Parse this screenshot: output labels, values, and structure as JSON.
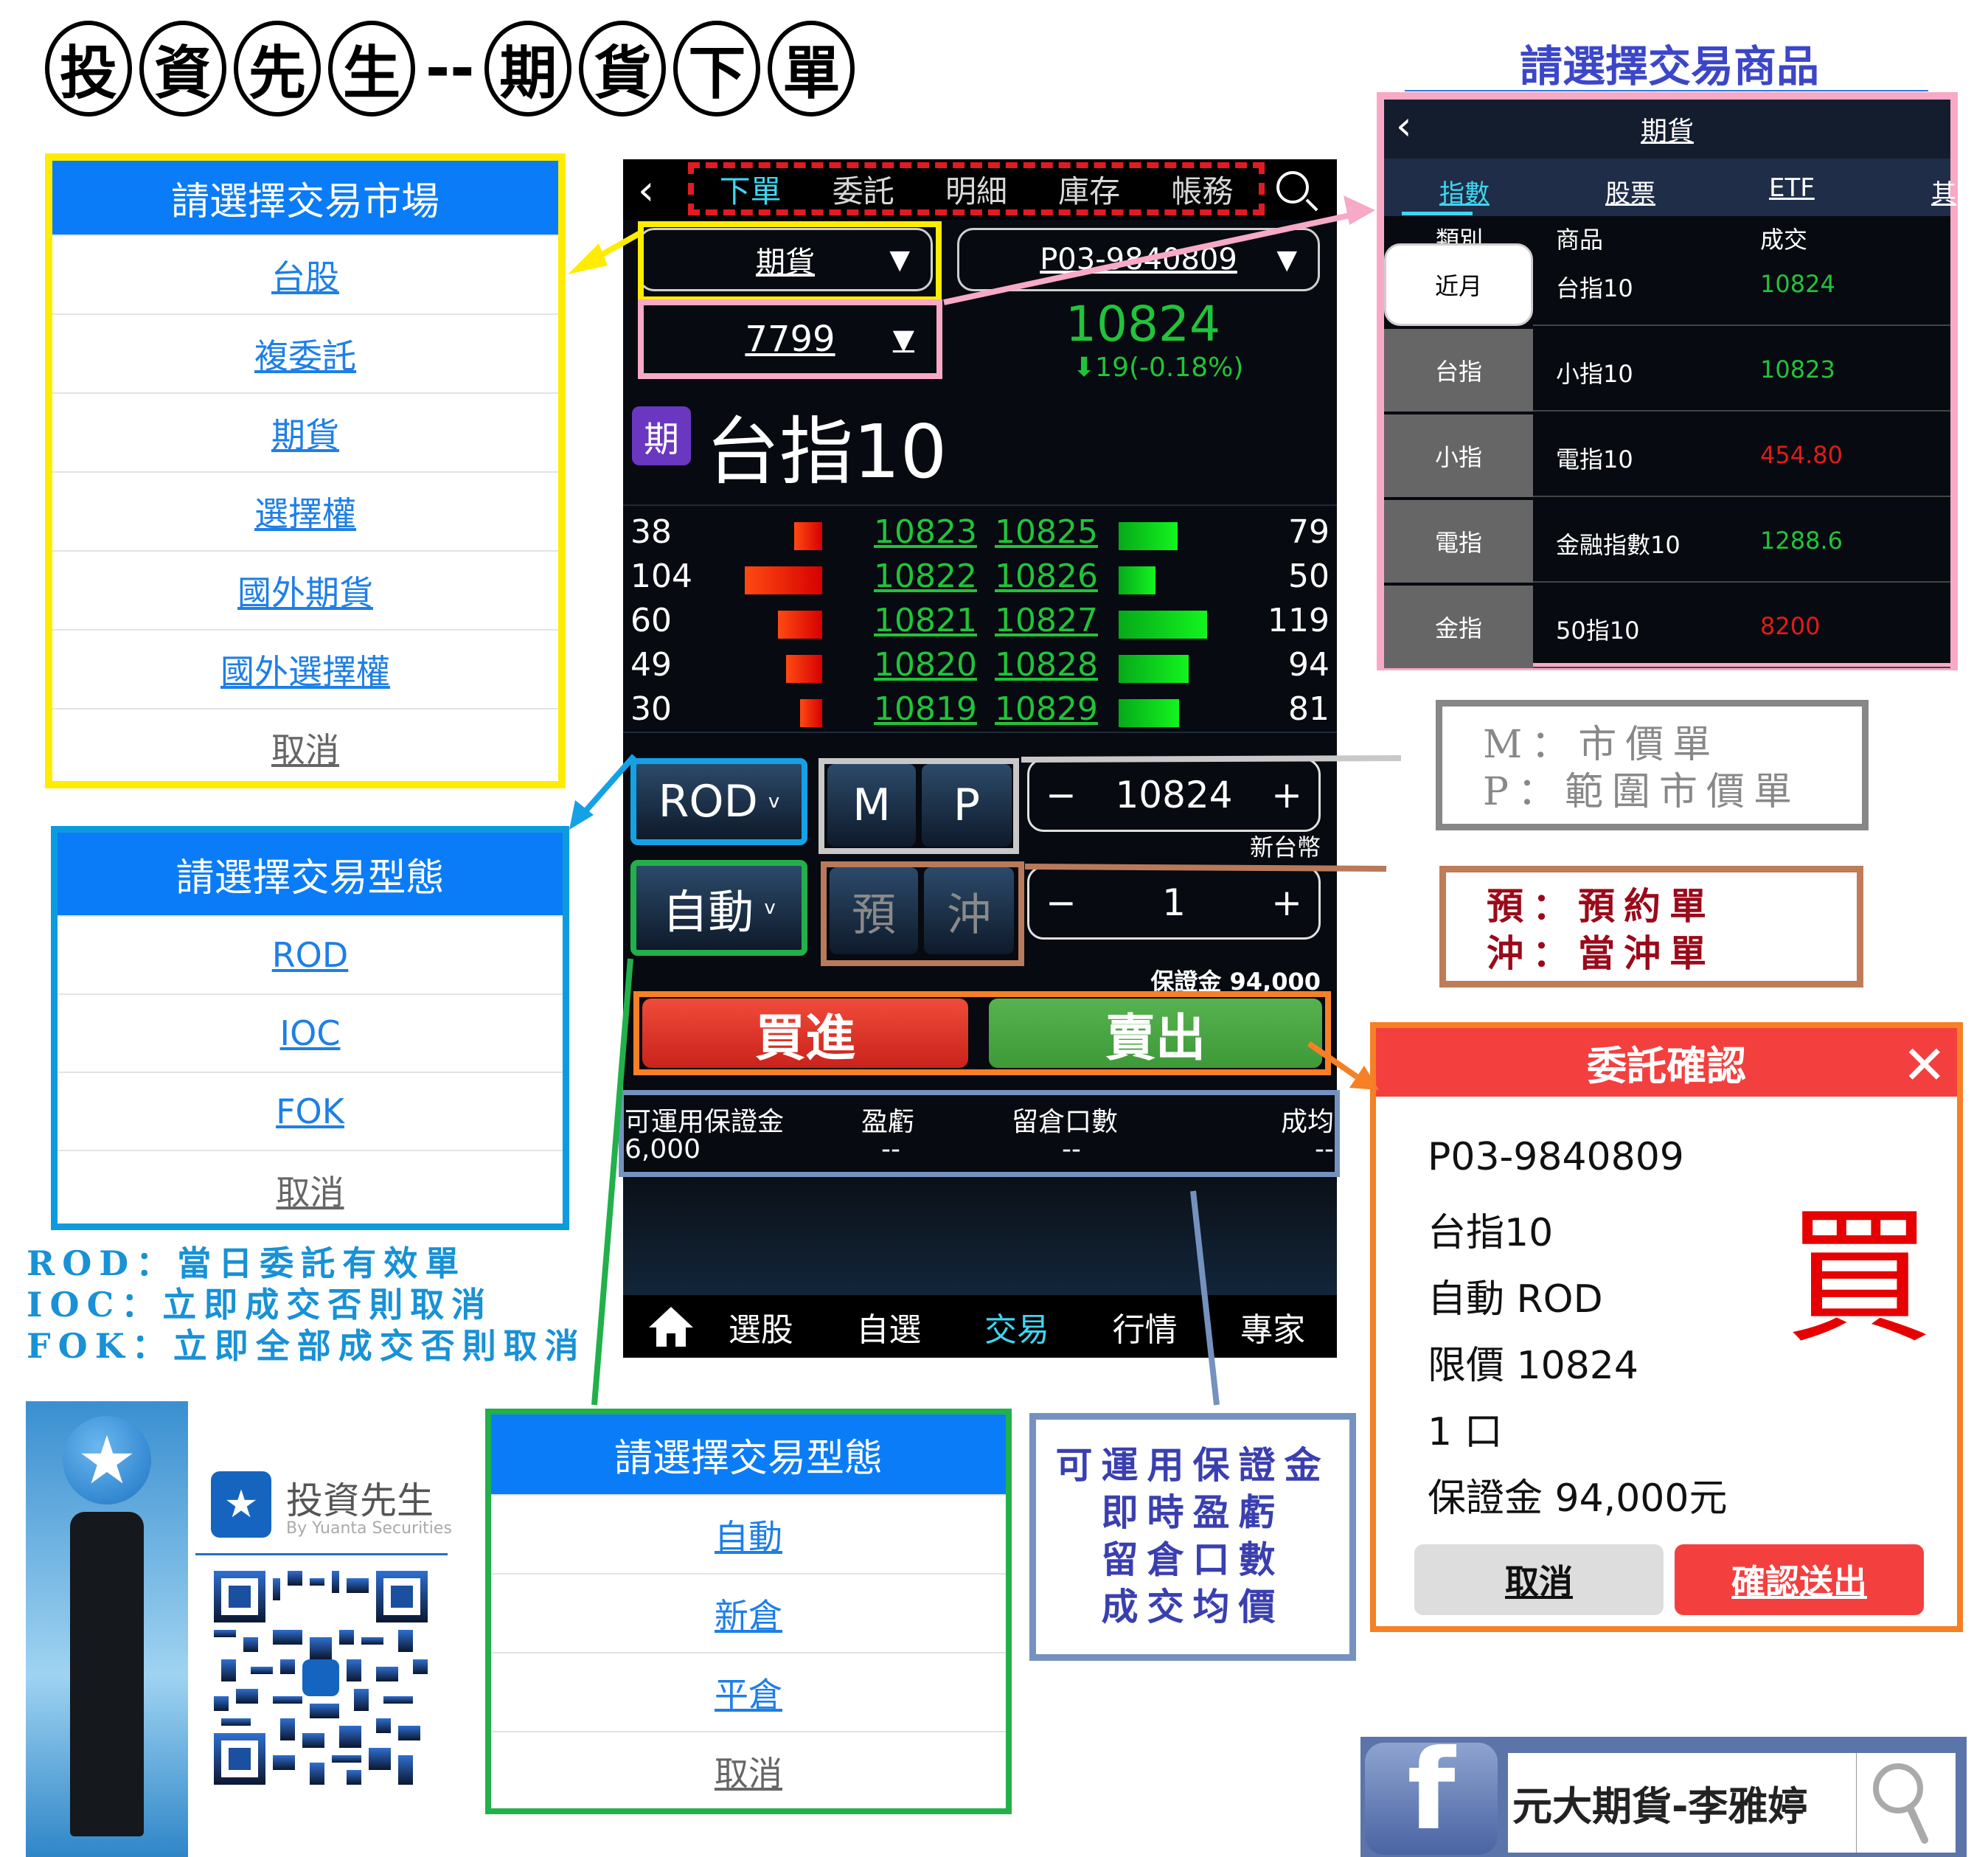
{
  "page_title": {
    "chars_left": [
      "投",
      "資",
      "先",
      "生"
    ],
    "separator": "--",
    "chars_right": [
      "期",
      "貨",
      "下",
      "單"
    ]
  },
  "phone": {
    "tabs": [
      {
        "label": "下單",
        "active": true
      },
      {
        "label": "委託",
        "active": false
      },
      {
        "label": "明細",
        "active": false
      },
      {
        "label": "庫存",
        "active": false
      },
      {
        "label": "帳務",
        "active": false
      }
    ],
    "market_select": "期貨",
    "account_select": "P03-9840809",
    "product_code_select": "7799",
    "last_price": "10824",
    "change": "19(-0.18%)",
    "change_direction": "down",
    "product_badge": "期",
    "product_name": "台指10",
    "order_book": [
      {
        "bid_qty": "38",
        "bid_price": "10823",
        "ask_price": "10825",
        "ask_qty": "79",
        "bid_bar": 38,
        "ask_bar": 79
      },
      {
        "bid_qty": "104",
        "bid_price": "10822",
        "ask_price": "10826",
        "ask_qty": "50",
        "bid_bar": 104,
        "ask_bar": 50
      },
      {
        "bid_qty": "60",
        "bid_price": "10821",
        "ask_price": "10827",
        "ask_qty": "119",
        "bid_bar": 60,
        "ask_bar": 119
      },
      {
        "bid_qty": "49",
        "bid_price": "10820",
        "ask_price": "10828",
        "ask_qty": "94",
        "bid_bar": 49,
        "ask_bar": 94
      },
      {
        "bid_qty": "30",
        "bid_price": "10819",
        "ask_price": "10829",
        "ask_qty": "81",
        "bid_bar": 30,
        "ask_bar": 81
      }
    ],
    "order_type": "ROD",
    "market_btn": "M",
    "range_btn": "P",
    "price_minus": "−",
    "price_value": "10824",
    "price_plus": "+",
    "currency": "新台幣",
    "position_type": "自動",
    "reserve_btn": "預",
    "daytrade_btn": "沖",
    "qty_minus": "−",
    "qty_value": "1",
    "qty_plus": "+",
    "margin_label": "保證金 94,000",
    "buy_label": "買進",
    "sell_label": "賣出",
    "account_info": {
      "headers": [
        "可運用保證金",
        "盈虧",
        "留倉口數",
        "成均"
      ],
      "values": [
        "6,000",
        "--",
        "--",
        "--"
      ]
    },
    "nav": [
      {
        "label": "選股",
        "active": false
      },
      {
        "label": "自選",
        "active": false
      },
      {
        "label": "交易",
        "active": true
      },
      {
        "label": "行情",
        "active": false
      },
      {
        "label": "專家",
        "active": false
      }
    ]
  },
  "market_dialog": {
    "title": "請選擇交易市場",
    "items": [
      "台股",
      "複委託",
      "期貨",
      "選擇權",
      "國外期貨",
      "國外選擇權"
    ],
    "cancel": "取消"
  },
  "order_type_dialog": {
    "title": "請選擇交易型態",
    "items": [
      "ROD",
      "IOC",
      "FOK"
    ],
    "cancel": "取消"
  },
  "order_type_legend": [
    "ROD：當日委託有效單",
    "IOC：立即成交否則取消",
    "FOK：立即全部成交否則取消"
  ],
  "position_dialog": {
    "title": "請選擇交易型態",
    "items": [
      "自動",
      "新倉",
      "平倉"
    ],
    "cancel": "取消"
  },
  "account_legend": [
    "可運用保證金",
    "即時盈虧",
    "留倉口數",
    "成交均價"
  ],
  "product_panel": {
    "caption": "請選擇交易商品",
    "title": "期貨",
    "tabs": [
      {
        "label": "指數",
        "active": true
      },
      {
        "label": "股票",
        "active": false
      },
      {
        "label": "ETF",
        "active": false
      },
      {
        "label": "其",
        "active": false
      }
    ],
    "headers": [
      "類別",
      "商品",
      "成交"
    ],
    "rows": [
      {
        "category": "近月",
        "product": "台指10",
        "price": "10824",
        "price_color": "#22c33a",
        "selected": true
      },
      {
        "category": "台指",
        "product": "小指10",
        "price": "10823",
        "price_color": "#22c33a",
        "selected": false
      },
      {
        "category": "小指",
        "product": "電指10",
        "price": "454.80",
        "price_color": "#e21b1b",
        "selected": false
      },
      {
        "category": "電指",
        "product": "金融指數10",
        "price": "1288.6",
        "price_color": "#22c33a",
        "selected": false
      },
      {
        "category": "金指",
        "product": "50指10",
        "price": "8200",
        "price_color": "#e21b1b",
        "selected": false
      }
    ]
  },
  "mp_legend": [
    "M：市價單",
    "P：範圍市價單"
  ],
  "reserve_legend": [
    "預：預約單",
    "沖：當沖單"
  ],
  "confirm_dialog": {
    "title": "委託確認",
    "lines": [
      "P03-9840809",
      "台指10",
      "自動 ROD",
      "限價 10824",
      "1 口",
      "保證金 94,000元"
    ],
    "side": "買",
    "cancel": "取消",
    "submit": "確認送出"
  },
  "brand": {
    "app_name": "投資先生",
    "app_sub": "By Yuanta Securities"
  },
  "facebook": {
    "search_text": "元大期貨-李雅婷"
  },
  "colors": {
    "up": "#e21b1b",
    "down": "#22c33a",
    "accent": "#3fd6f0",
    "dialog_blue": "#0a7cf7"
  }
}
